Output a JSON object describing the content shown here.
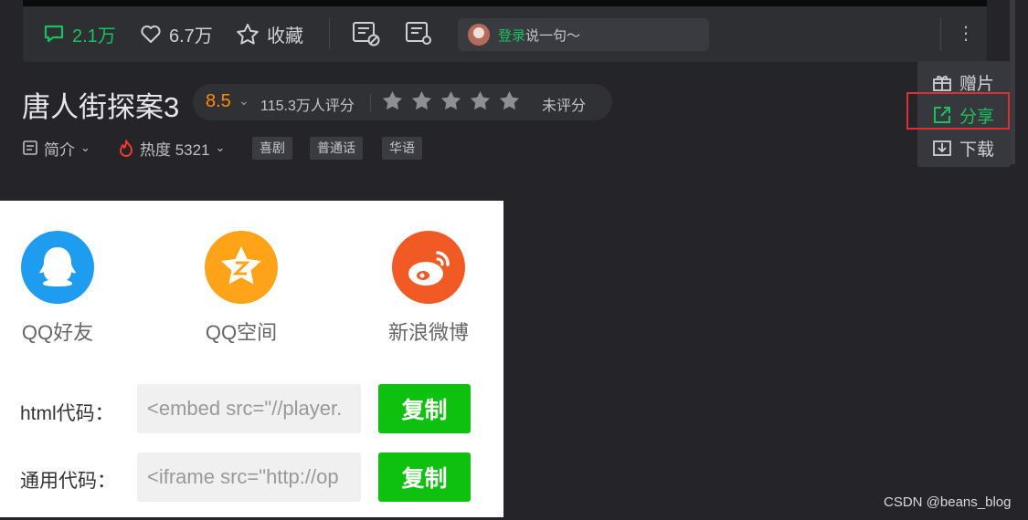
{
  "toolbar": {
    "comment_count": "2.1万",
    "like_count": "6.7万",
    "favorite_label": "收藏",
    "login_link": "登录",
    "login_placeholder": "说一句～",
    "more_icon": "⋮"
  },
  "show": {
    "title": "唐人街探案3",
    "score": "8.5",
    "rating_count": "115.3万人评分",
    "unrated_label": "未评分",
    "stars": 5
  },
  "meta": {
    "intro_label": "简介",
    "heat_label": "热度 5321",
    "tags": [
      "喜剧",
      "普通话",
      "华语"
    ]
  },
  "more_menu": {
    "items": [
      {
        "label": "赠片",
        "icon": "gift-icon"
      },
      {
        "label": "分享",
        "icon": "share-icon"
      },
      {
        "label": "下载",
        "icon": "download-icon"
      }
    ],
    "highlight_color": "#e02f33"
  },
  "share_card": {
    "platforms": [
      {
        "label": "QQ好友",
        "icon": "qq-icon",
        "color": "#1e9cf0"
      },
      {
        "label": "QQ空间",
        "icon": "qzone-icon",
        "color": "#ffa318"
      },
      {
        "label": "新浪微博",
        "icon": "weibo-icon",
        "color": "#f15a24"
      }
    ],
    "html_code_label": "html代码：",
    "html_code_value": "<embed src=\"//player.",
    "generic_code_label": "通用代码：",
    "generic_code_value": "<iframe src=\"http://op",
    "copy_button": "复制"
  },
  "colors": {
    "accent_green": "#19c15e",
    "score_orange": "#ff8a00",
    "copy_green": "#0ec10e"
  },
  "watermark": "CSDN @beans_blog"
}
